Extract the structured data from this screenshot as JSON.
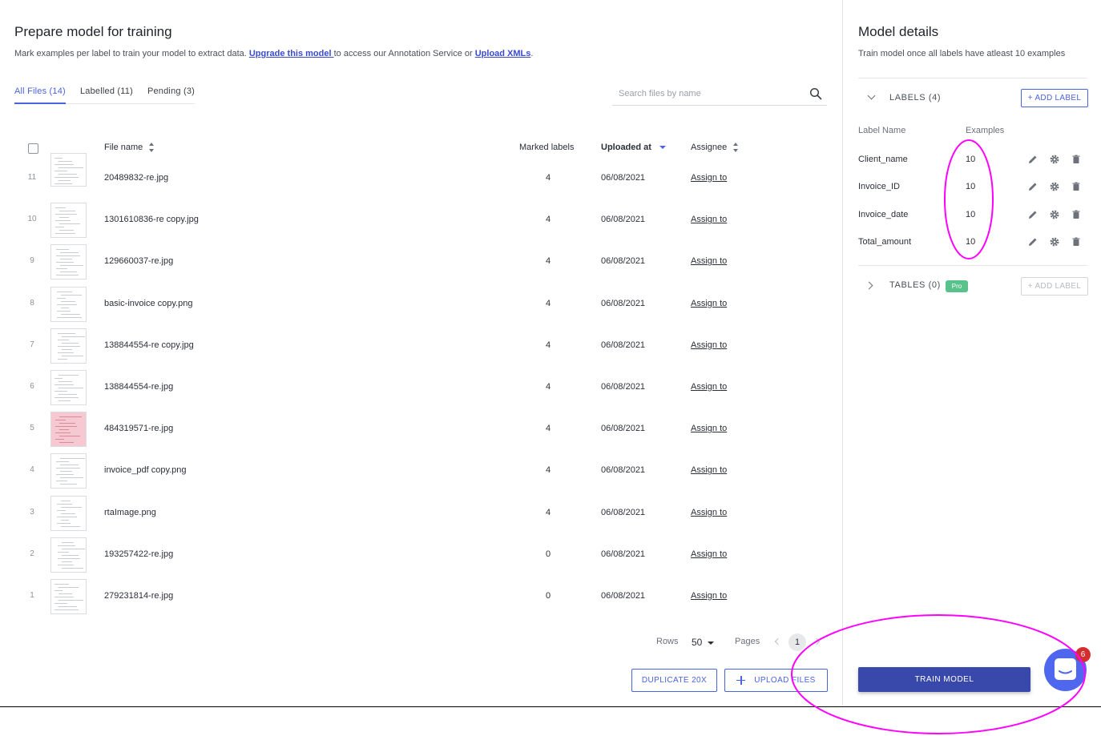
{
  "header": {
    "title": "Prepare model for training",
    "subtitle_before": "Mark examples per label to train your model to extract data. ",
    "upgrade_link": "Upgrade this model ",
    "subtitle_middle": "to access our Annotation Service or ",
    "upload_xml_link": "Upload XMLs",
    "subtitle_after": "."
  },
  "tabs": [
    {
      "label": "All Files (14)",
      "active": true
    },
    {
      "label": "Labelled (11)",
      "active": false
    },
    {
      "label": "Pending (3)",
      "active": false
    }
  ],
  "search": {
    "placeholder": "Search files by name",
    "value": ""
  },
  "table": {
    "columns": {
      "file_name": "File name",
      "marked_labels": "Marked labels",
      "uploaded_at": "Uploaded at",
      "assignee": "Assignee"
    },
    "rows": [
      {
        "num": "11",
        "file": "20489832-re.jpg",
        "marked": "4",
        "date": "06/08/2021",
        "assign": "Assign to"
      },
      {
        "num": "10",
        "file": "1301610836-re copy.jpg",
        "marked": "4",
        "date": "06/08/2021",
        "assign": "Assign to"
      },
      {
        "num": "9",
        "file": "129660037-re.jpg",
        "marked": "4",
        "date": "06/08/2021",
        "assign": "Assign to"
      },
      {
        "num": "8",
        "file": "basic-invoice copy.png",
        "marked": "4",
        "date": "06/08/2021",
        "assign": "Assign to"
      },
      {
        "num": "7",
        "file": "138844554-re copy.jpg",
        "marked": "4",
        "date": "06/08/2021",
        "assign": "Assign to"
      },
      {
        "num": "6",
        "file": "138844554-re.jpg",
        "marked": "4",
        "date": "06/08/2021",
        "assign": "Assign to"
      },
      {
        "num": "5",
        "file": "484319571-re.jpg",
        "marked": "4",
        "date": "06/08/2021",
        "assign": "Assign to"
      },
      {
        "num": "4",
        "file": "invoice_pdf copy.png",
        "marked": "4",
        "date": "06/08/2021",
        "assign": "Assign to"
      },
      {
        "num": "3",
        "file": "rtaImage.png",
        "marked": "4",
        "date": "06/08/2021",
        "assign": "Assign to"
      },
      {
        "num": "2",
        "file": "193257422-re.jpg",
        "marked": "0",
        "date": "06/08/2021",
        "assign": "Assign to"
      },
      {
        "num": "1",
        "file": "279231814-re.jpg",
        "marked": "0",
        "date": "06/08/2021",
        "assign": "Assign to"
      }
    ]
  },
  "pagination": {
    "rows_label": "Rows",
    "rows_value": "50",
    "pages_label": "Pages",
    "current_page": "1"
  },
  "actions": {
    "duplicate": "DUPLICATE 20X",
    "upload": "UPLOAD FILES"
  },
  "model": {
    "title": "Model details",
    "subtitle": "Train model once all labels have atleast 10 examples",
    "labels_section": "LABELS (4)",
    "add_label": "+ ADD LABEL",
    "col_name": "Label Name",
    "col_examples": "Examples",
    "labels": [
      {
        "name": "Client_name",
        "count": "10"
      },
      {
        "name": "Invoice_ID",
        "count": "10"
      },
      {
        "name": "Invoice_date",
        "count": "10"
      },
      {
        "name": "Total_amount",
        "count": "10"
      }
    ],
    "tables_section": "TABLES (0)",
    "pro_badge": "Pro",
    "add_table_label": "+ ADD LABEL",
    "train_button": "TRAIN MODEL"
  },
  "chat": {
    "badge": "6"
  },
  "colors": {
    "accent": "#4a63e0",
    "train": "#3949ab",
    "annotation": "#ff00ff",
    "pro": "#58c28a",
    "badge": "#d32f2f"
  }
}
